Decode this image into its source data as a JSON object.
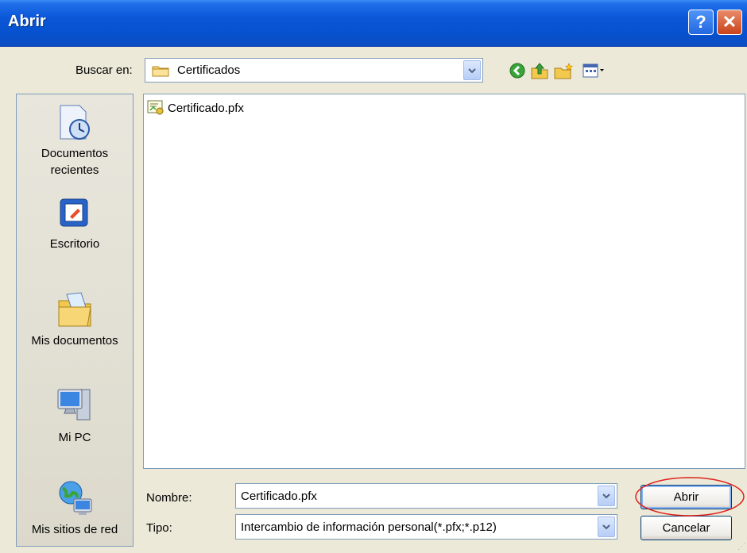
{
  "window": {
    "title": "Abrir",
    "help_glyph": "?",
    "close_glyph": "✕"
  },
  "toolbar": {
    "look_in_label": "Buscar en:",
    "look_in_value": "Certificados",
    "icons": [
      "back-icon",
      "up-folder-icon",
      "new-folder-icon",
      "view-menu-icon"
    ]
  },
  "places": [
    {
      "label": "Documentos recientes",
      "icon": "recent-documents-icon"
    },
    {
      "label": "Escritorio",
      "icon": "desktop-icon"
    },
    {
      "label": "Mis documentos",
      "icon": "my-documents-icon"
    },
    {
      "label": "Mi PC",
      "icon": "my-computer-icon"
    },
    {
      "label": "Mis sitios de red",
      "icon": "network-places-icon"
    }
  ],
  "files": [
    {
      "name": "Certificado.pfx",
      "icon": "certificate-file-icon"
    }
  ],
  "form": {
    "name_label": "Nombre:",
    "name_value": "Certificado.pfx",
    "type_label": "Tipo:",
    "type_value": "Intercambio de información personal(*.pfx;*.p12)"
  },
  "buttons": {
    "open": "Abrir",
    "cancel": "Cancelar"
  },
  "colors": {
    "titlebar": "#0752cf",
    "dialog_bg": "#ece9d8",
    "highlight": "#e0201a"
  }
}
